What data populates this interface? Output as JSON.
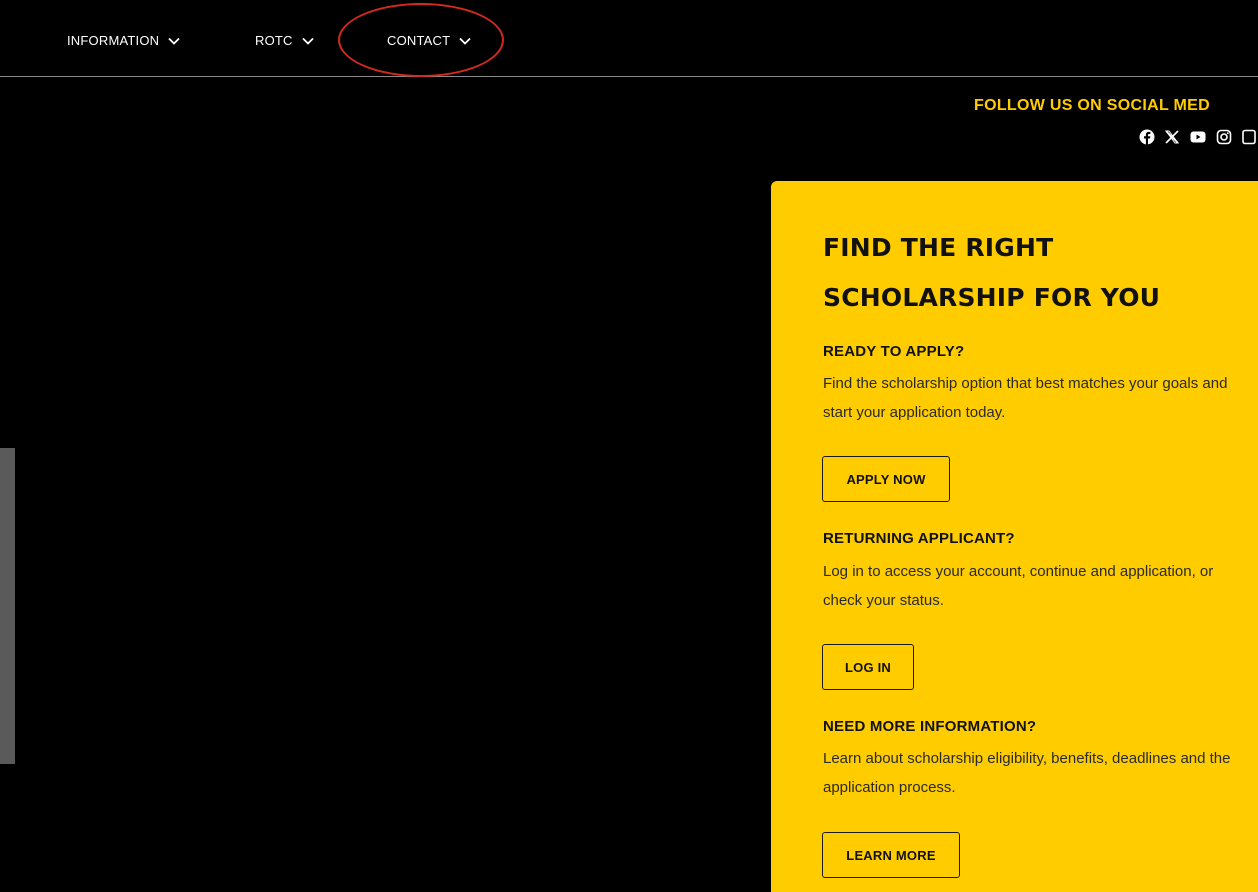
{
  "nav": {
    "items": [
      {
        "label": "INFORMATION"
      },
      {
        "label": "ROTC"
      },
      {
        "label": "CONTACT"
      }
    ]
  },
  "social": {
    "title": "FOLLOW US ON SOCIAL MED",
    "icons": [
      "facebook-icon",
      "x-icon",
      "youtube-icon",
      "instagram-icon"
    ]
  },
  "card": {
    "title": "FIND THE RIGHT SCHOLARSHIP FOR YOU",
    "sections": [
      {
        "heading": "READY TO APPLY?",
        "text": "Find the scholarship option that best matches your goals and start your application today.",
        "button": "APPLY NOW"
      },
      {
        "heading": "RETURNING APPLICANT?",
        "text": "Log in to access your account, continue and application, or check your status.",
        "button": "LOG IN"
      },
      {
        "heading": "NEED MORE INFORMATION?",
        "text": "Learn about scholarship eligibility, benefits, deadlines and the application process.",
        "button": "LEARN MORE"
      }
    ]
  },
  "colors": {
    "accent": "#ffcc00",
    "background": "#000000",
    "highlight": "#d42a1e"
  }
}
